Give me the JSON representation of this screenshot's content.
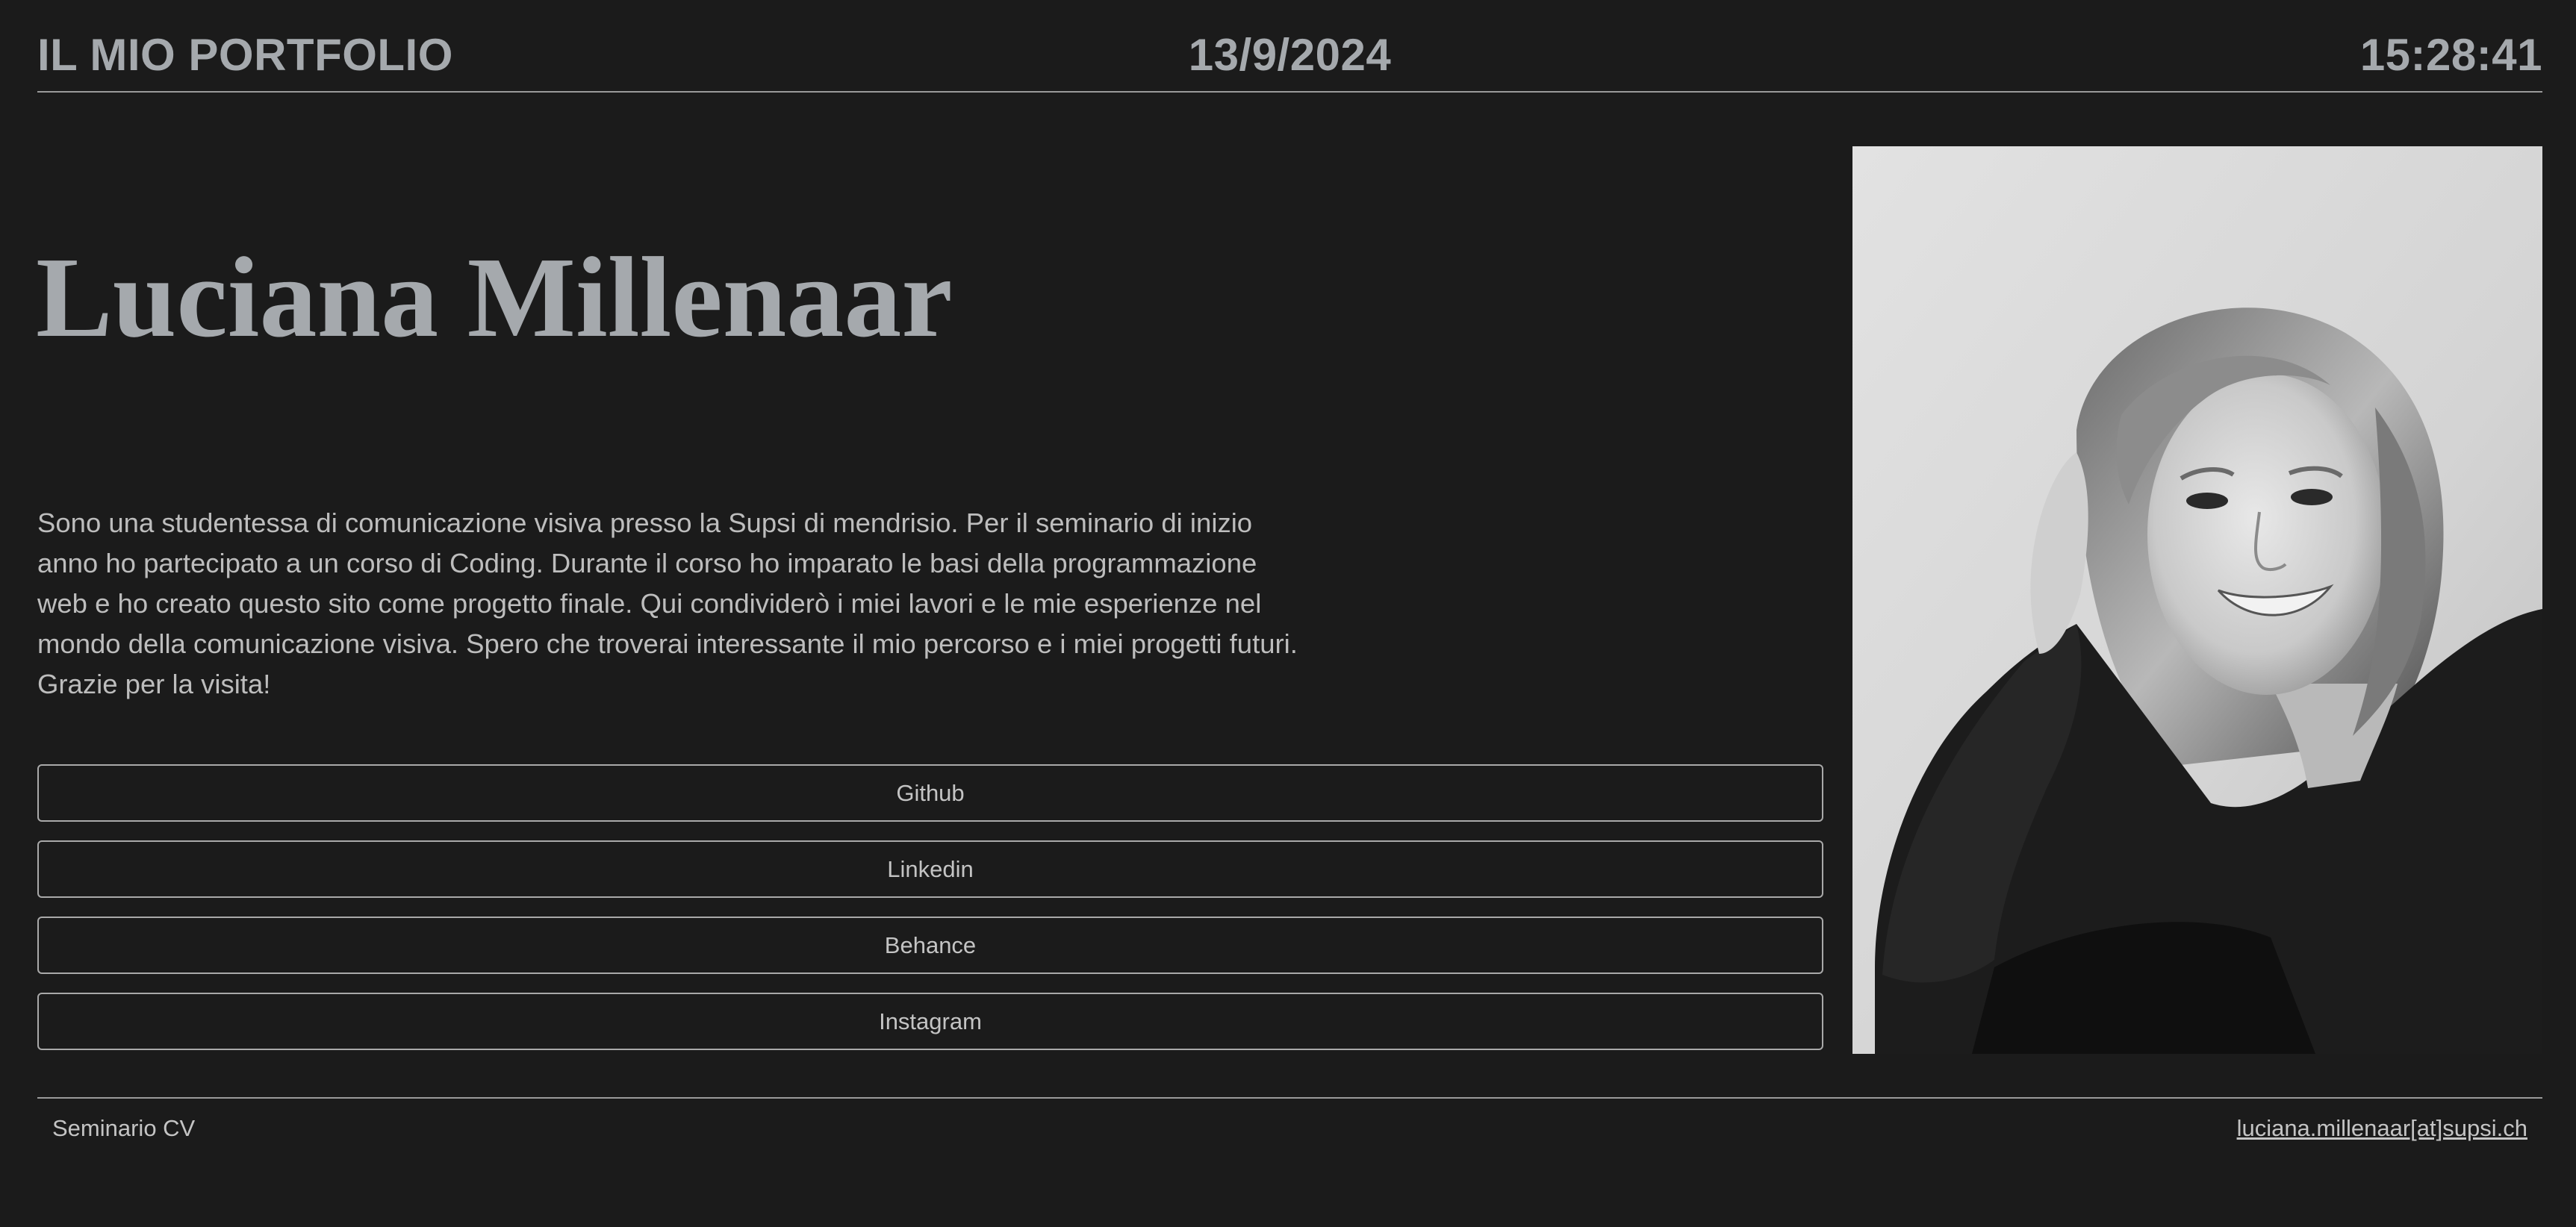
{
  "header": {
    "title": "IL MIO PORTFOLIO",
    "date": "13/9/2024",
    "time": "15:28:41"
  },
  "profile": {
    "name": "Luciana Millenaar",
    "bio": "Sono una studentessa di comunicazione visiva presso la Supsi di mendrisio. Per il seminario di inizio anno ho partecipato a un corso di Coding. Durante il corso ho imparato le basi della programmazione web e ho creato questo sito come progetto finale. Qui condividerò i miei lavori e le mie esperienze nel mondo della comunicazione visiva. Spero che troverai interessante il mio percorso e i miei progetti futuri. Grazie per la visita!"
  },
  "links": [
    {
      "label": "Github"
    },
    {
      "label": "Linkedin"
    },
    {
      "label": "Behance"
    },
    {
      "label": "Instagram"
    }
  ],
  "footer": {
    "left": "Seminario CV",
    "email": "luciana.millenaar[at]supsi.ch"
  },
  "colors": {
    "background": "#1b1b1b",
    "heading": "#a5a9ad",
    "text": "#bdbdbd",
    "border": "#a9a9a9"
  }
}
